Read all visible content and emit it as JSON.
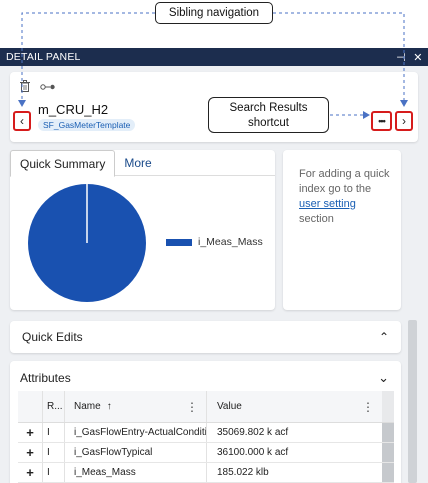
{
  "callouts": {
    "sibling_navigation": "Sibling navigation",
    "search_results_line1": "Search Results",
    "search_results_line2": "shortcut"
  },
  "panel": {
    "title": "DETAIL PANEL",
    "pin_icon": "⊣",
    "close_icon": "✕"
  },
  "entity": {
    "name": "m_CRU_H2",
    "template": "SF_GasMeterTemplate",
    "prev_label": "‹",
    "next_label": "›",
    "more_label": "•••"
  },
  "summary": {
    "tabs": [
      {
        "label": "Quick Summary",
        "active": true
      },
      {
        "label": "More",
        "active": false
      }
    ]
  },
  "chart_data": {
    "type": "pie",
    "categories": [
      "i_Meas_Mass"
    ],
    "values": [
      100
    ],
    "colors": [
      "#1951b0"
    ],
    "legend_position": "right"
  },
  "info": {
    "text_before": "For adding a quick index go to the ",
    "link": "user setting",
    "text_after": " section"
  },
  "quick_edits": {
    "label": "Quick Edits",
    "chevron": "⌃"
  },
  "attributes": {
    "label": "Attributes",
    "chevron": "⌄",
    "columns": {
      "r": "R...",
      "name": "Name",
      "sort_indicator": "↑",
      "value": "Value",
      "menu": "⋮"
    },
    "rows": [
      {
        "expand": "+",
        "r": "I",
        "name": "i_GasFlowEntry-ActualConditio...",
        "value": "35069.802 k acf"
      },
      {
        "expand": "+",
        "r": "I",
        "name": "i_GasFlowTypical",
        "value": "36100.000 k acf"
      },
      {
        "expand": "+",
        "r": "I",
        "name": "i_Meas_Mass",
        "value": "185.022 klb"
      }
    ]
  }
}
